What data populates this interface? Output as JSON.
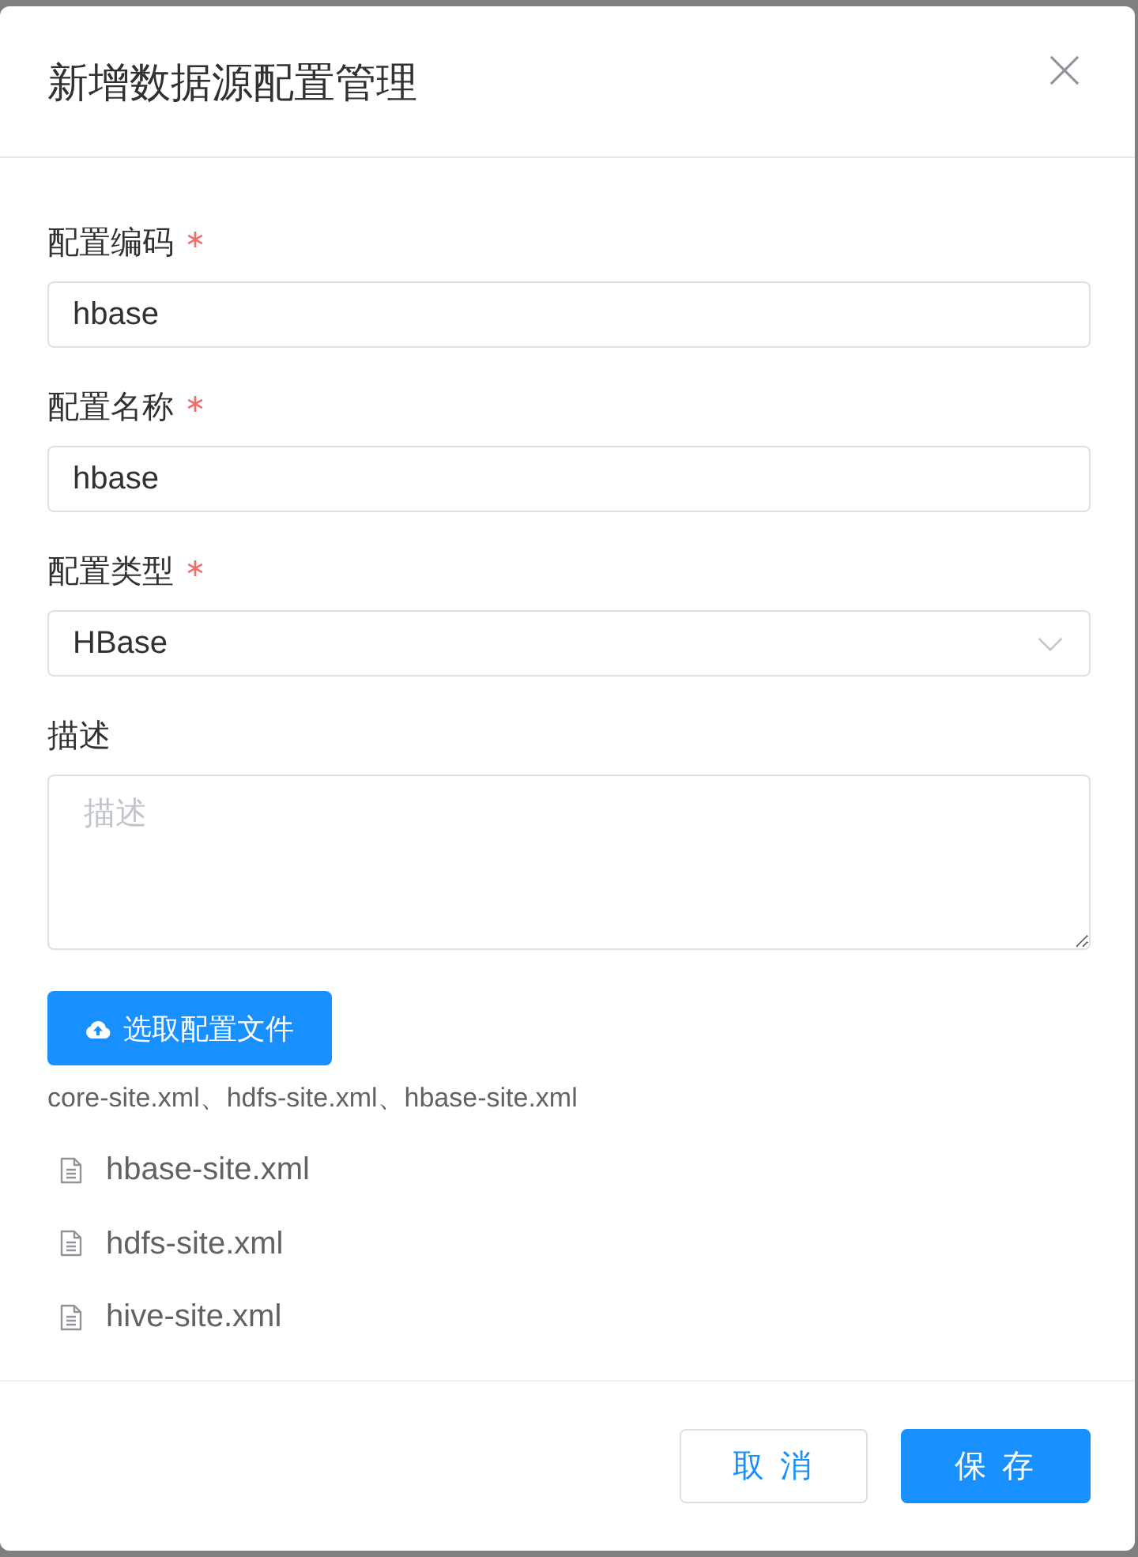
{
  "dialog": {
    "title": "新增数据源配置管理"
  },
  "fields": [
    {
      "kind": "input",
      "label": "配置编码",
      "required": true,
      "value": "hbase"
    },
    {
      "kind": "input",
      "label": "配置名称",
      "required": true,
      "value": "hbase"
    },
    {
      "kind": "select",
      "label": "配置类型",
      "required": true,
      "value": "HBase"
    },
    {
      "kind": "textarea",
      "label": "描述",
      "required": false,
      "placeholder": "描述"
    }
  ],
  "upload": {
    "button": "选取配置文件",
    "hint": "core-site.xml、hdfs-site.xml、hbase-site.xml",
    "files": [
      "hbase-site.xml",
      "hdfs-site.xml",
      "hive-site.xml"
    ]
  },
  "footer": {
    "buttons": [
      {
        "kind": "secondary",
        "label": "取 消"
      },
      {
        "kind": "primary",
        "label": "保 存"
      }
    ]
  }
}
